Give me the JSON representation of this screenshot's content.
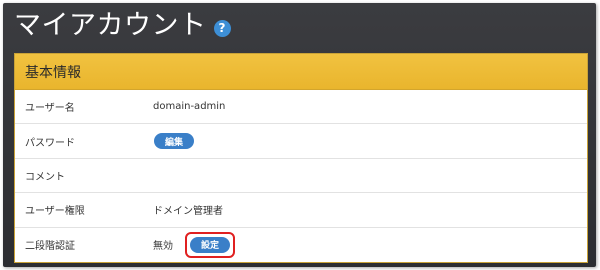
{
  "page": {
    "title": "マイアカウント",
    "help_icon": "question-circle-icon",
    "help_glyph": "?"
  },
  "panel": {
    "header": "基本情報",
    "rows": [
      {
        "label": "ユーザー名",
        "value": "domain-admin"
      },
      {
        "label": "パスワード",
        "button": "編集"
      },
      {
        "label": "コメント",
        "value": ""
      },
      {
        "label": "ユーザー権限",
        "value": "ドメイン管理者"
      },
      {
        "label": "二段階認証",
        "status": "無効",
        "button": "設定"
      }
    ]
  },
  "colors": {
    "header_bg": "#2c2d31",
    "panel_header_bg": "#f1c240",
    "button_bg": "#3a7fc8",
    "highlight_border": "#e02020"
  }
}
